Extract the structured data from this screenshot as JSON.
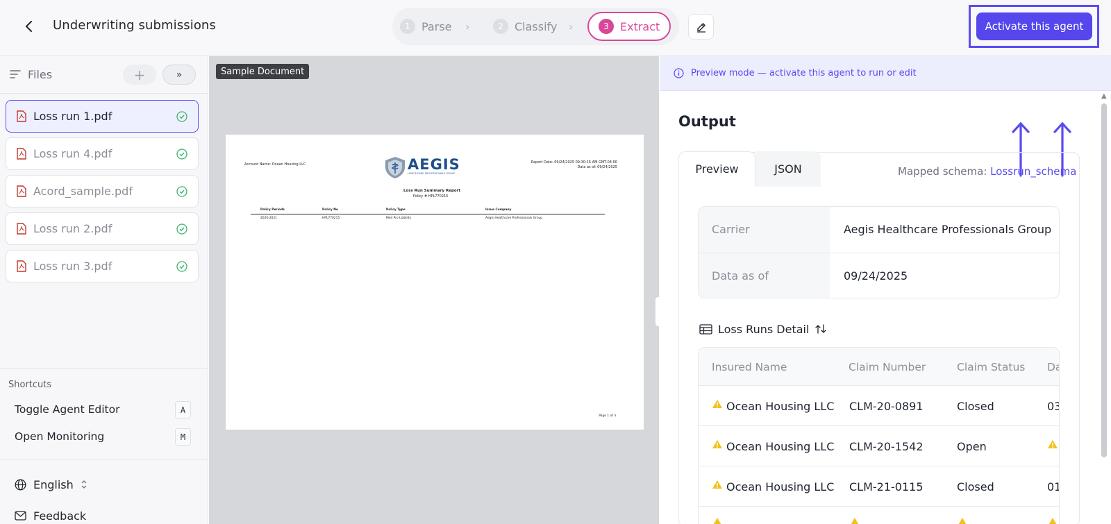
{
  "header": {
    "title": "Underwriting submissions",
    "steps": [
      {
        "num": "1",
        "label": "Parse"
      },
      {
        "num": "2",
        "label": "Classify"
      },
      {
        "num": "3",
        "label": "Extract"
      }
    ],
    "activate_label": "Activate this agent"
  },
  "sidebar": {
    "files_label": "Files",
    "add_label": "+",
    "expand_label": "»",
    "files": [
      {
        "name": "Loss run 1.pdf"
      },
      {
        "name": "Loss run 4.pdf"
      },
      {
        "name": "Acord_sample.pdf"
      },
      {
        "name": "Loss run 2.pdf"
      },
      {
        "name": "Loss run 3.pdf"
      }
    ],
    "shortcuts_title": "Shortcuts",
    "shortcuts": [
      {
        "label": "Toggle Agent Editor",
        "key": "A"
      },
      {
        "label": "Open Monitoring",
        "key": "M"
      }
    ],
    "language": "English",
    "feedback": "Feedback"
  },
  "document": {
    "tag": "Sample Document",
    "account_name": "Account Name: Ocean Housing LLC",
    "logo_text": "AEGIS",
    "logo_sub": "HEALTHCARE PROFESSIONALS GROUP",
    "report_date": "Report Date: 09/24/2025 09:30:15 AM GMT-04:00",
    "data_as_of": "Data as of: 09/24/2025",
    "report_title": "Loss Run Summary Report",
    "policy_line": "Policy # HPL770215",
    "table_headers": [
      "Policy Periods",
      "Policy No",
      "Policy Type",
      "Issue Company"
    ],
    "table_row": [
      "2020-2021",
      "HPL770215",
      "Med Pro Liability",
      "Aegis Healthcare Professionals Group"
    ],
    "page_label": "Page 1 of 3"
  },
  "output": {
    "banner": "Preview mode — activate this agent to run or edit",
    "title": "Output",
    "tabs": [
      "Preview",
      "JSON"
    ],
    "schema_prefix": "Mapped schema: ",
    "schema_name": "Lossrun_schema",
    "fields": [
      {
        "key": "Carrier",
        "value": "Aegis Healthcare Professionals Group"
      },
      {
        "key": "Data as of",
        "value": "09/24/2025"
      }
    ],
    "detail_title": "Loss Runs Detail",
    "table_headers": [
      "Insured Name",
      "Claim Number",
      "Claim Status",
      "Da"
    ],
    "rows": [
      {
        "insured": "Ocean Housing LLC",
        "claim": "CLM-20-0891",
        "status": "Closed",
        "date": "03"
      },
      {
        "insured": "Ocean Housing LLC",
        "claim": "CLM-20-1542",
        "status": "Open",
        "date": ""
      },
      {
        "insured": "Ocean Housing LLC",
        "claim": "CLM-21-0115",
        "status": "Closed",
        "date": "01"
      }
    ]
  },
  "colors": {
    "accent": "#5546ee",
    "extract_pink": "#d8479a",
    "warning": "#f2c21b",
    "pdf_red": "#c0392b",
    "success_green": "#3bb36b"
  }
}
